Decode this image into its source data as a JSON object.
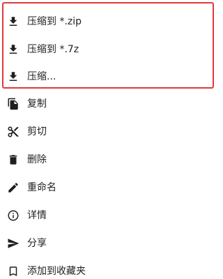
{
  "menu": {
    "items": [
      {
        "label": "压缩到 *.zip",
        "icon": "download-icon"
      },
      {
        "label": "压缩到 *.7z",
        "icon": "download-icon"
      },
      {
        "label": "压缩...",
        "icon": "download-icon"
      },
      {
        "label": "复制",
        "icon": "copy-icon"
      },
      {
        "label": "剪切",
        "icon": "scissors-icon"
      },
      {
        "label": "删除",
        "icon": "trash-icon"
      },
      {
        "label": "重命名",
        "icon": "pencil-icon"
      },
      {
        "label": "详情",
        "icon": "info-icon"
      },
      {
        "label": "分享",
        "icon": "share-icon"
      },
      {
        "label": "添加到收藏夹",
        "icon": "bookmark-icon"
      }
    ]
  },
  "colors": {
    "highlight_border": "#e23838",
    "icon": "#1f1f1f",
    "text": "#222222",
    "background": "#ffffff"
  }
}
